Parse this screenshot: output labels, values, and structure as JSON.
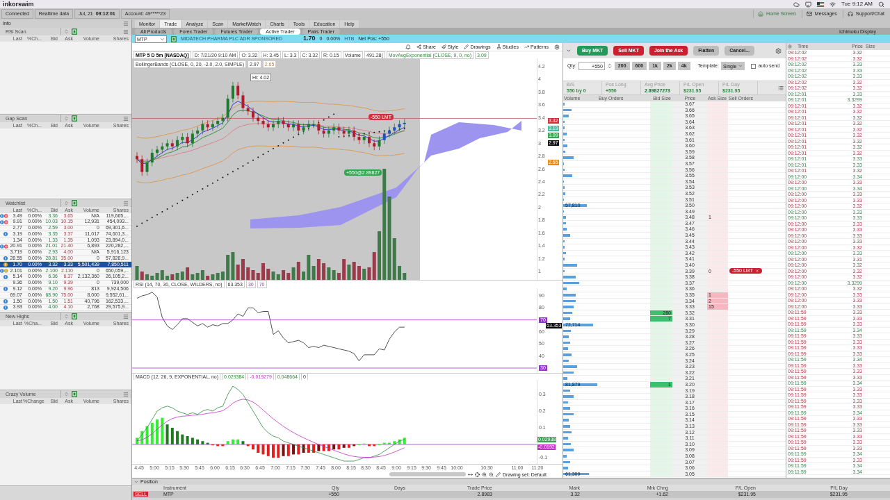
{
  "menubar": {
    "app": "inkorswim",
    "clock": "Tue 9:12 AM"
  },
  "status": {
    "items": [
      "Connected",
      "Realtime data"
    ],
    "date": "Jul, 21",
    "time": "09:12:01",
    "account": "Account: 49*****23"
  },
  "header_links": [
    "Home Screen",
    "Messages",
    "Support/Chat"
  ],
  "left": {
    "title": "Info",
    "panels": [
      {
        "name": "RSI Scan",
        "columns": [
          "Last",
          "%Ch...",
          "Bid",
          "Ask",
          "Volume",
          "Shares"
        ]
      },
      {
        "name": "Gap Scan",
        "columns": [
          "Last",
          "%Ch...",
          "Bid",
          "Ask",
          "Volume",
          "Shares"
        ]
      },
      {
        "name": "Watchlist",
        "columns": [
          "Last",
          "%Ch...",
          "Bid",
          "Ask",
          "Volume",
          "Shares"
        ],
        "rows": [
          {
            "icons": [
              {
                "kind": "info"
              },
              {
                "kind": "alert"
              }
            ],
            "last": "3.49",
            "change": "0.00%",
            "bid": "3.36",
            "ask": "3.65",
            "volume": "N/A",
            "shares": "119,665,...",
            "selected": false
          },
          {
            "icons": [
              {
                "kind": "info"
              },
              {
                "kind": "alert"
              }
            ],
            "last": "9.91",
            "change": "0.00%",
            "bid": "10.03",
            "ask": "10.15",
            "volume": "12,931",
            "shares": "454,093...",
            "selected": false
          },
          {
            "last": "2.77",
            "change": "0.00%",
            "bid": "2.59",
            "ask": "3.00",
            "volume": "0",
            "shares": "69,301,6...",
            "selected": false
          },
          {
            "icons": [
              {
                "kind": "info"
              }
            ],
            "last": "3.19",
            "change": "0.00%",
            "bid": "3.35",
            "ask": "3.37",
            "volume": "11,017",
            "shares": "74,601,3...",
            "selected": false
          },
          {
            "last": "1.34",
            "change": "0.00%",
            "bid": "1.33",
            "ask": "1.35",
            "volume": "1,093",
            "shares": "23,894,0...",
            "selected": false
          },
          {
            "icons": [
              {
                "kind": "info"
              },
              {
                "kind": "alert"
              }
            ],
            "last": "20.91",
            "change": "0.00%",
            "bid": "21.01",
            "ask": "21.40",
            "volume": "6,893",
            "shares": "220,282,...",
            "selected": false
          },
          {
            "last": "3.719",
            "change": "0.00%",
            "bid": "2.93",
            "ask": "4.00",
            "volume": "N/A",
            "shares": "5,916,123",
            "selected": false
          },
          {
            "icons": [
              {
                "kind": "info"
              }
            ],
            "last": "28.55",
            "change": "0.00%",
            "bid": "28.81",
            "ask": "35.00",
            "volume": "0",
            "shares": "57,828,9...",
            "selected": false
          },
          {
            "icons": [
              {
                "kind": "note"
              }
            ],
            "last": "1.70",
            "change": "0.00%",
            "bid": "3.32",
            "ask": "3.33",
            "volume": "5,501,439",
            "shares": "7,850,511",
            "selected": true
          },
          {
            "icons": [
              {
                "kind": "info"
              },
              {
                "kind": "note"
              }
            ],
            "last": "2.101",
            "change": "0.00%",
            "bid": "2.100",
            "ask": "2.110",
            "volume": "0",
            "shares": "650,059,...",
            "selected": false
          },
          {
            "icons": [
              {
                "kind": "info"
              }
            ],
            "last": "5.14",
            "change": "0.00%",
            "bid": "6.36",
            "ask": "6.37",
            "volume": "2,132,360",
            "shares": "26,105,2...",
            "selected": false
          },
          {
            "last": "9.36",
            "change": "0.00%",
            "bid": "9.10",
            "ask": "9.39",
            "volume": "0",
            "shares": "739,000",
            "selected": false
          },
          {
            "icons": [
              {
                "kind": "info"
              }
            ],
            "last": "9.12",
            "change": "0.00%",
            "bid": "9.20",
            "ask": "9.96",
            "volume": "813",
            "shares": "9,924,506",
            "selected": false
          },
          {
            "last": "69.07",
            "change": "0.00%",
            "bid": "68.90",
            "ask": "75.00",
            "volume": "8,000",
            "shares": "9,552,61...",
            "selected": false
          },
          {
            "icons": [
              {
                "kind": "info"
              }
            ],
            "last": "1.50",
            "change": "0.00%",
            "bid": "1.50",
            "ask": "1.51",
            "volume": "40,796",
            "shares": "162,533,...",
            "selected": false
          },
          {
            "icons": [
              {
                "kind": "info"
              }
            ],
            "last": "3.93",
            "change": "0.00%",
            "bid": "4.00",
            "ask": "4.10",
            "volume": "2,768",
            "shares": "29,575,9...",
            "selected": false
          }
        ]
      },
      {
        "name": "New Highs",
        "columns": [
          "Last",
          "%Cha...",
          "Bid",
          "Ask",
          "Volume",
          "Shares"
        ]
      },
      {
        "name": "Crazy Volume",
        "columns": [
          "Last",
          "%Change",
          "Bid",
          "Ask",
          "Volume",
          "Shares"
        ]
      }
    ]
  },
  "tabs": [
    {
      "label": "Monitor",
      "selected": false
    },
    {
      "label": "Trade",
      "selected": true
    },
    {
      "label": "Analyze",
      "selected": false
    },
    {
      "label": "Scan",
      "selected": false
    },
    {
      "label": "MarketWatch",
      "selected": false
    },
    {
      "label": "Charts",
      "selected": false
    },
    {
      "label": "Tools",
      "selected": false
    },
    {
      "label": "Education",
      "selected": false
    },
    {
      "label": "Help",
      "selected": false
    }
  ],
  "subtabs": [
    {
      "label": "All Products",
      "selected": false
    },
    {
      "label": "Forex Trader",
      "selected": false
    },
    {
      "label": "Futures Trader",
      "selected": false
    },
    {
      "label": "Active Trader",
      "selected": true
    },
    {
      "label": "Pairs Trader",
      "selected": false
    }
  ],
  "layout_name": "Ichimoku Display",
  "symbol_bar": {
    "symbol": "MTP",
    "description": "MIDATECH PHARMA PLC ADR SPONSORED",
    "last": "1.70",
    "change": "0",
    "change_pct": "0.00%",
    "htb": "HTB",
    "net_pos": "Net Pos: +550"
  },
  "chart_toolbar": [
    "Share",
    "Style",
    "Drawings",
    "Studies",
    "Patterns"
  ],
  "chart": {
    "legend": [
      {
        "text": "MTP 5 D 5m [NASDAQ]",
        "kind": "symbol"
      },
      {
        "text": "D: 7/21/20 9:10 AM",
        "kind": "text"
      },
      {
        "text": "O: 3.32",
        "kind": "text"
      },
      {
        "text": "H: 3.45",
        "kind": "text"
      },
      {
        "text": "L: 3.3",
        "kind": "text"
      },
      {
        "text": "C: 3.32",
        "kind": "text"
      },
      {
        "text": "R: 0.15",
        "kind": "text"
      },
      {
        "text": "Volume",
        "kind": "text"
      },
      {
        "text": "491.28(",
        "kind": "text"
      },
      {
        "text": "MovAvgExponential (CLOSE, 9, 0, no)",
        "kind": "ema"
      },
      {
        "text": "3.09",
        "kind": "ema"
      },
      {
        "text": "BollingerBands (CLOSE, 0, 20, -2.0, 2.0, SIMPLE)",
        "kind": "text"
      },
      {
        "text": "2.97",
        "kind": "text"
      },
      {
        "text": "2.65",
        "kind": "band"
      }
    ],
    "hi_label": "Hi: 4.02",
    "order_label": "-550 LMT",
    "fill_label": "+550@2.89827",
    "price_ticks": [
      "4.2",
      "4",
      "3.8",
      "3.6",
      "3.4",
      "3.2",
      "3",
      "2.8",
      "2.6",
      "2.4",
      "2.2",
      "2",
      "1.8",
      "1.6",
      "1.4",
      "1.2",
      "1"
    ],
    "price_tags": [
      {
        "text": "3.32",
        "color": "#d0303a"
      },
      {
        "text": "3.19",
        "color": "#3fbf9a"
      },
      {
        "text": "3.09",
        "color": "#2ea84a"
      },
      {
        "text": "2.97",
        "color": "#111111"
      },
      {
        "text": "2.65",
        "color": "#e08a20"
      }
    ],
    "rsi_legend": [
      {
        "text": "RSI (14, 70, 30, CLOSE, WILDERS, no)",
        "kind": "text"
      },
      {
        "text": "63.353",
        "kind": "text"
      },
      {
        "text": "30",
        "kind": "level"
      },
      {
        "text": "70",
        "kind": "level"
      }
    ],
    "rsi_ticks": [
      {
        "text": "90",
        "kind": "tick"
      },
      {
        "text": "80",
        "kind": "tick"
      },
      {
        "text": "70",
        "kind": "tag"
      },
      {
        "text": "60",
        "kind": "tick"
      },
      {
        "text": "50",
        "kind": "tick"
      },
      {
        "text": "40",
        "kind": "tick"
      },
      {
        "text": "30",
        "kind": "tag"
      }
    ],
    "rsi_value": "63.353",
    "macd_legend": [
      {
        "text": "MACD (12, 26, 9, EXPONENTIAL, no)",
        "kind": "text"
      },
      {
        "text": "0.029384",
        "kind": "macd"
      },
      {
        "text": "-0.019279",
        "kind": "signal"
      },
      {
        "text": "0.048664",
        "kind": "macd"
      },
      {
        "text": "0",
        "kind": "text"
      }
    ],
    "macd_ticks": [
      "0.3",
      "0.2",
      "0.1",
      "-0.1"
    ],
    "macd_tags": [
      {
        "text": "0.02938",
        "color": "#2ea84a"
      },
      {
        "text": "-0.0192",
        "color": "#c030c0"
      }
    ],
    "time_ticks": [
      "4:45",
      "5:00",
      "5:15",
      "5:30",
      "5:45",
      "6:00",
      "6:15",
      "6:30",
      "6:45",
      "7:00",
      "7:15",
      "7:30",
      "7:45",
      "8:00",
      "8:15",
      "8:30",
      "8:45",
      "9:00",
      "9:15",
      "9:30",
      "9:45",
      "10:00",
      "10:30",
      "11:00",
      "11:20"
    ],
    "drawing_set": "Drawing set: Default"
  },
  "trader": {
    "buttons": [
      {
        "label": "Buy MKT",
        "kind": "buy"
      },
      {
        "label": "Sell MKT",
        "kind": "sell"
      },
      {
        "label": "Join the Ask",
        "kind": "sell"
      },
      {
        "label": "Flatten",
        "kind": "neutral"
      },
      {
        "label": "Cancel...",
        "kind": "neutral"
      }
    ],
    "qty_label": "Qty:",
    "qty": "+550",
    "quick": [
      "200",
      "600",
      "1k",
      "2k",
      "4k"
    ],
    "template_label": "Template:",
    "template": "Single",
    "auto_send": {
      "label": "auto send",
      "checked": false
    },
    "stats": [
      {
        "label": "B/S",
        "value": "550 by 0"
      },
      {
        "label": "Pos Long",
        "value": "+550"
      },
      {
        "label": "Avg Price",
        "value": "2.89827273"
      },
      {
        "label": "P/L Open",
        "value": "$231.95"
      },
      {
        "label": "P/L Day",
        "value": "$231.95"
      }
    ],
    "columns": [
      "Volume",
      "Buy Orders",
      "Bid Size",
      "Price",
      "Ask Size",
      "Sell Orders"
    ],
    "ladder": [
      {
        "price": "3.67",
        "level": 0.04
      },
      {
        "price": "3.66",
        "level": 0.24
      },
      {
        "price": "3.65",
        "level": 0.16
      },
      {
        "price": "3.64",
        "level": 0.04
      },
      {
        "price": "3.63",
        "level": 0.04
      },
      {
        "price": "3.62",
        "level": 0.1
      },
      {
        "price": "3.61",
        "level": 0.04
      },
      {
        "price": "3.60",
        "level": 0.12
      },
      {
        "price": "3.59",
        "level": 0.06
      },
      {
        "price": "3.58",
        "level": 0.3
      },
      {
        "price": "3.57",
        "level": 0.02
      },
      {
        "price": "3.56",
        "level": 0.04
      },
      {
        "price": "3.55",
        "level": 0.26
      },
      {
        "price": "3.54",
        "level": 0.02
      },
      {
        "price": "3.53",
        "level": 0.04
      },
      {
        "price": "3.52",
        "level": 0.06
      },
      {
        "price": "3.51",
        "level": 0.01
      },
      {
        "price": "3.50",
        "level": 0.68,
        "volume": "57,810"
      },
      {
        "price": "3.49",
        "level": 0.02
      },
      {
        "price": "3.48",
        "level": 0.08,
        "ask": {
          "size": "1",
          "highlight": false
        }
      },
      {
        "price": "3.47",
        "level": 0.08
      },
      {
        "price": "3.46",
        "level": 0.1
      },
      {
        "price": "3.45",
        "level": 0.2
      },
      {
        "price": "3.44",
        "level": 0.04
      },
      {
        "price": "3.43",
        "level": 0.04
      },
      {
        "price": "3.42",
        "level": 0.08
      },
      {
        "price": "3.41",
        "level": 0.04
      },
      {
        "price": "3.40",
        "level": 0.4
      },
      {
        "price": "3.39",
        "level": 0.04,
        "ask": {
          "size": "0",
          "highlight": false
        },
        "sell_order": "-550 LMT"
      },
      {
        "price": "3.38",
        "level": 0.36
      },
      {
        "price": "3.37",
        "level": 0.46
      },
      {
        "price": "3.36",
        "level": 0.1
      },
      {
        "price": "3.35",
        "level": 0.36,
        "ask": {
          "size": "1",
          "highlight": true
        }
      },
      {
        "price": "3.34",
        "level": 0.36,
        "ask": {
          "size": "2",
          "highlight": true
        }
      },
      {
        "price": "3.33",
        "level": 0.3,
        "ask": {
          "size": "15",
          "highlight": true
        }
      },
      {
        "price": "3.32",
        "level": 0.26,
        "bid": {
          "size": "280",
          "highlight": true
        }
      },
      {
        "price": "3.31",
        "level": 0.2,
        "bid": {
          "size": "7",
          "highlight": true
        }
      },
      {
        "price": "3.30",
        "level": 0.86,
        "volume": "72,714"
      },
      {
        "price": "3.29",
        "level": 0.22
      },
      {
        "price": "3.28",
        "level": 0.16
      },
      {
        "price": "3.27",
        "level": 0.2
      },
      {
        "price": "3.26",
        "level": 0.14
      },
      {
        "price": "3.25",
        "level": 0.24
      },
      {
        "price": "3.24",
        "level": 0.16
      },
      {
        "price": "3.23",
        "level": 0.4
      },
      {
        "price": "3.22",
        "level": 0.3
      },
      {
        "price": "3.21",
        "level": 0.12
      },
      {
        "price": "3.20",
        "level": 0.98,
        "volume": "81,879",
        "bid": {
          "size": "1",
          "highlight": true
        }
      },
      {
        "price": "3.19",
        "level": 0.2
      },
      {
        "price": "3.18",
        "level": 0.3
      },
      {
        "price": "3.17",
        "level": 0.14
      },
      {
        "price": "3.16",
        "level": 0.2
      },
      {
        "price": "3.15",
        "level": 0.3
      },
      {
        "price": "3.14",
        "level": 0.16
      },
      {
        "price": "3.13",
        "level": 0.2
      },
      {
        "price": "3.12",
        "level": 0.24
      },
      {
        "price": "3.11",
        "level": 0.14
      },
      {
        "price": "3.10",
        "level": 0.22
      },
      {
        "price": "3.09",
        "level": 0.3
      },
      {
        "price": "3.08",
        "level": 0.1
      },
      {
        "price": "3.07",
        "level": 0.2
      },
      {
        "price": "3.06",
        "level": 0.14
      },
      {
        "price": "3.05",
        "level": 0.74,
        "volume": "61,309"
      }
    ]
  },
  "time_sales": {
    "columns": [
      "Time",
      "Price",
      "Size"
    ],
    "rows": [
      {
        "time": "09:12:02",
        "price": "3.32",
        "kind": "down"
      },
      {
        "time": "09:12:02",
        "price": "3.32",
        "kind": "down"
      },
      {
        "time": "09:12:02",
        "price": "3.33",
        "kind": "up"
      },
      {
        "time": "09:12:02",
        "price": "3.33",
        "kind": "up"
      },
      {
        "time": "09:12:02",
        "price": "3.33",
        "kind": "up"
      },
      {
        "time": "09:12:02",
        "price": "3.32",
        "kind": "down"
      },
      {
        "time": "09:12:02",
        "price": "3.32",
        "kind": "down"
      },
      {
        "time": "09:12:01",
        "price": "3.33",
        "kind": "up"
      },
      {
        "time": "09:12:01",
        "price": "3.3299",
        "kind": "up"
      },
      {
        "time": "09:12:01",
        "price": "3.32",
        "kind": "down"
      },
      {
        "time": "09:12:01",
        "price": "3.32",
        "kind": "down"
      },
      {
        "time": "09:12:01",
        "price": "3.32",
        "kind": "down"
      },
      {
        "time": "09:12:01",
        "price": "3.32",
        "kind": "down"
      },
      {
        "time": "09:12:01",
        "price": "3.32",
        "kind": "down"
      },
      {
        "time": "09:12:01",
        "price": "3.32",
        "kind": "down"
      },
      {
        "time": "09:12:01",
        "price": "3.32",
        "kind": "down"
      },
      {
        "time": "09:12:01",
        "price": "3.32",
        "kind": "down"
      },
      {
        "time": "09:12:01",
        "price": "3.32",
        "kind": "down"
      },
      {
        "time": "09:12:01",
        "price": "3.33",
        "kind": "up"
      },
      {
        "time": "09:12:01",
        "price": "3.33",
        "kind": "up"
      },
      {
        "time": "09:12:01",
        "price": "3.32",
        "kind": "down"
      },
      {
        "time": "09:12:00",
        "price": "3.34",
        "kind": "up"
      },
      {
        "time": "09:12:00",
        "price": "3.33",
        "kind": "down"
      },
      {
        "time": "09:12:00",
        "price": "3.34",
        "kind": "up"
      },
      {
        "time": "09:12:00",
        "price": "3.33",
        "kind": "down"
      },
      {
        "time": "09:12:00",
        "price": "3.33",
        "kind": "down"
      },
      {
        "time": "09:12:00",
        "price": "3.32",
        "kind": "down"
      },
      {
        "time": "09:12:00",
        "price": "3.33",
        "kind": "up"
      },
      {
        "time": "09:12:00",
        "price": "3.33",
        "kind": "up"
      },
      {
        "time": "09:12:00",
        "price": "3.33",
        "kind": "down"
      },
      {
        "time": "09:12:00",
        "price": "3.33",
        "kind": "down"
      },
      {
        "time": "09:12:00",
        "price": "3.33",
        "kind": "down"
      },
      {
        "time": "09:12:00",
        "price": "3.33",
        "kind": "down"
      },
      {
        "time": "09:12:00",
        "price": "3.32",
        "kind": "down"
      },
      {
        "time": "09:12:00",
        "price": "3.33",
        "kind": "up"
      },
      {
        "time": "09:12:00",
        "price": "3.31",
        "kind": "down"
      },
      {
        "time": "09:12:00",
        "price": "3.32",
        "kind": "down"
      },
      {
        "time": "09:12:00",
        "price": "3.32",
        "kind": "down"
      },
      {
        "time": "09:12:00",
        "price": "3.32",
        "kind": "down"
      },
      {
        "time": "09:12:00",
        "price": "3.3299",
        "kind": "up"
      },
      {
        "time": "09:12:00",
        "price": "3.32",
        "kind": "down"
      },
      {
        "time": "09:12:00",
        "price": "3.33",
        "kind": "down"
      },
      {
        "time": "09:12:00",
        "price": "3.33",
        "kind": "down"
      },
      {
        "time": "09:12:00",
        "price": "3.33",
        "kind": "down"
      },
      {
        "time": "09:11:59",
        "price": "3.33",
        "kind": "down"
      },
      {
        "time": "09:11:59",
        "price": "3.33",
        "kind": "down"
      },
      {
        "time": "09:11:59",
        "price": "3.33",
        "kind": "down"
      },
      {
        "time": "09:11:59",
        "price": "3.34",
        "kind": "up"
      },
      {
        "time": "09:11:59",
        "price": "3.33",
        "kind": "down"
      },
      {
        "time": "09:11:59",
        "price": "3.33",
        "kind": "down"
      },
      {
        "time": "09:11:59",
        "price": "3.33",
        "kind": "down"
      },
      {
        "time": "09:11:59",
        "price": "3.33",
        "kind": "down"
      },
      {
        "time": "09:11:59",
        "price": "3.34",
        "kind": "up"
      },
      {
        "time": "09:11:59",
        "price": "3.33",
        "kind": "down"
      },
      {
        "time": "09:11:59",
        "price": "3.33",
        "kind": "down"
      },
      {
        "time": "09:11:59",
        "price": "3.33",
        "kind": "down"
      },
      {
        "time": "09:11:59",
        "price": "3.34",
        "kind": "up"
      },
      {
        "time": "09:11:59",
        "price": "3.33",
        "kind": "down"
      },
      {
        "time": "09:11:59",
        "price": "3.33",
        "kind": "down"
      },
      {
        "time": "09:11:59",
        "price": "3.33",
        "kind": "down"
      },
      {
        "time": "09:11:59",
        "price": "3.33",
        "kind": "down"
      },
      {
        "time": "09:11:59",
        "price": "3.34",
        "kind": "up"
      },
      {
        "time": "09:11:59",
        "price": "3.33",
        "kind": "down"
      },
      {
        "time": "09:11:59",
        "price": "3.33",
        "kind": "down"
      },
      {
        "time": "09:11:59",
        "price": "3.33",
        "kind": "down"
      },
      {
        "time": "09:11:59",
        "price": "3.33",
        "kind": "down"
      },
      {
        "time": "09:11:59",
        "price": "3.33",
        "kind": "down"
      },
      {
        "time": "09:11:59",
        "price": "3.33",
        "kind": "down"
      },
      {
        "time": "09:11:59",
        "price": "3.34",
        "kind": "up"
      },
      {
        "time": "09:11:59",
        "price": "3.33",
        "kind": "down"
      },
      {
        "time": "09:11:59",
        "price": "3.34",
        "kind": "up"
      },
      {
        "time": "09:11:59",
        "price": "3.34",
        "kind": "up"
      }
    ]
  },
  "position": {
    "title": "Position",
    "columns": [
      "Instrument",
      "Qty",
      "Days",
      "Trade Price",
      "Mark",
      "Mrk Chng",
      "P/L Open",
      "P/L Day"
    ],
    "rows": [
      {
        "badge": "SELL",
        "instrument": "MTP",
        "qty": "+550",
        "trade_price": "2.8983",
        "mark": "3.32",
        "mark_change": "+1.62",
        "pl_open": "$231.95",
        "pl_day": "$231.95"
      }
    ]
  }
}
